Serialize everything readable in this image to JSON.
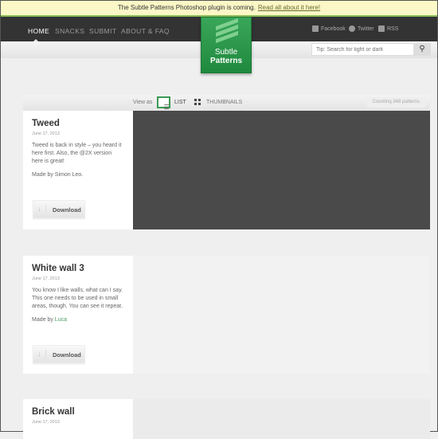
{
  "banner": {
    "text": "The Subtle Patterns Photoshop plugin is coming.",
    "link": "Read all about it here!"
  },
  "nav": {
    "items": [
      "HOME",
      "SNACKS",
      "SUBMIT",
      "ABOUT & FAQ"
    ],
    "active": "HOME"
  },
  "social": [
    "Facebook",
    "Twitter",
    "RSS"
  ],
  "logo": {
    "line1": "Subtle",
    "line2": "Patterns"
  },
  "search": {
    "placeholder": "Tip: Search for light or dark"
  },
  "viewbar": {
    "view_as": "View as",
    "list": "LIST",
    "thumbnails": "THUMBNAILS",
    "count": "Counting 348 patterns."
  },
  "patterns": [
    {
      "title": "Tweed",
      "date": "June 17, 2013",
      "desc": "Tweed is back in style – you heard it here first. Also, the @2X version here is great!",
      "made_by": "Made by Simon Leo.",
      "author": "",
      "download": "Download",
      "color": "#4a4a4a"
    },
    {
      "title": "White wall 3",
      "date": "June 17, 2013",
      "desc": "You know I like walls, what can I say. This one needs to be used in small areas, though. You can see it repeat.",
      "made_by": "Made by ",
      "author": "Luca",
      "download": "Download",
      "color": "#f2f2f2"
    },
    {
      "title": "Brick wall",
      "date": "June 17, 2013",
      "color": "#ececec"
    }
  ]
}
